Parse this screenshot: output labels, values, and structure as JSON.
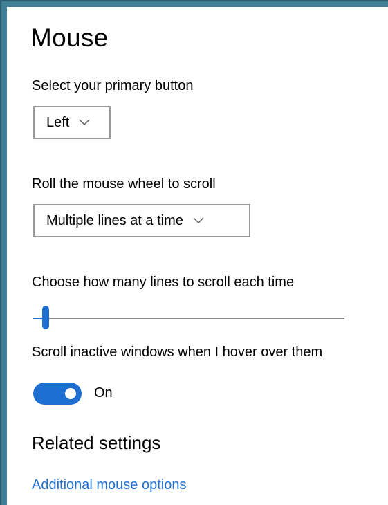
{
  "page": {
    "title": "Mouse"
  },
  "primary_button": {
    "label": "Select your primary button",
    "value": "Left"
  },
  "scroll_mode": {
    "label": "Roll the mouse wheel to scroll",
    "value": "Multiple lines at a time"
  },
  "lines_slider": {
    "label": "Choose how many lines to scroll each time",
    "value_fraction": 0.03
  },
  "inactive_scroll": {
    "label": "Scroll inactive windows when I hover over them",
    "state_label": "On",
    "is_on": true
  },
  "related": {
    "title": "Related settings",
    "link": "Additional mouse options"
  },
  "colors": {
    "accent": "#1e6fd1",
    "window_border": "#3f7f95",
    "dropdown_border": "#999999",
    "slider_track": "#8a8a8a"
  },
  "icons": {
    "dropdown_chevron": "chevron-down-icon"
  }
}
